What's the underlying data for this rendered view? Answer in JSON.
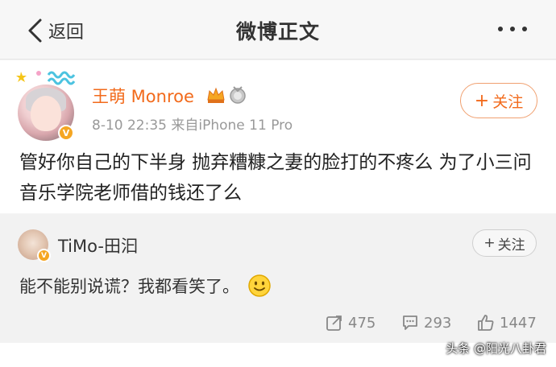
{
  "nav": {
    "back_label": "返回",
    "title": "微博正文"
  },
  "post": {
    "username": "王萌 Monroe",
    "meta": "8-10 22:35  来自iPhone 11 Pro",
    "follow_label": "关注",
    "text": "管好你自己的下半身 抛弃糟糠之妻的脸打的不疼么  为了小三问音乐学院老师借的钱还了么"
  },
  "comment": {
    "username": "TiMo-田汩",
    "follow_label": "关注",
    "text": "能不能别说谎？我都看笑了。"
  },
  "stats": {
    "reposts": "475",
    "comments": "293",
    "likes": "1447"
  },
  "watermark": "头条 @阳光八卦君",
  "colors": {
    "accent": "#f26a1b",
    "verified": "#f5a623"
  }
}
